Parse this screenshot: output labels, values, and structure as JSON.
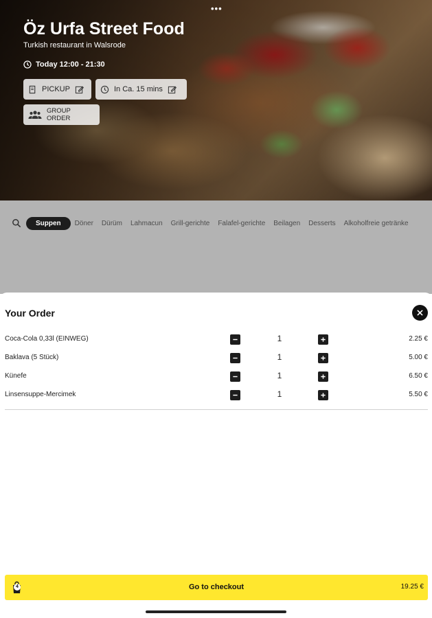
{
  "header": {
    "restaurant_name": "Öz Urfa Street Food",
    "subtitle": "Turkish restaurant in Walsrode",
    "hours": "Today 12:00 - 21:30",
    "pickup_label": "PICKUP",
    "time_label": "In Ca. 15 mins",
    "group_order_label": "GROUP ORDER",
    "menu_dots": "•••"
  },
  "categories": {
    "active": "Suppen",
    "items": [
      "Döner",
      "Dürüm",
      "Lahmacun",
      "Grill-gerichte",
      "Falafel-gerichte",
      "Beilagen",
      "Desserts",
      "Alkoholfreie getränke"
    ]
  },
  "order": {
    "title": "Your Order",
    "items": [
      {
        "name": "Coca-Cola 0,33l (EINWEG)",
        "qty": "1",
        "price": "2.25 €"
      },
      {
        "name": "Baklava (5 Stück)",
        "qty": "1",
        "price": "5.00 €"
      },
      {
        "name": "Künefe",
        "qty": "1",
        "price": "6.50 €"
      },
      {
        "name": "Linsensuppe-Mercimek",
        "qty": "1",
        "price": "5.50 €"
      }
    ]
  },
  "checkout": {
    "label": "Go to checkout",
    "total": "19.25 €",
    "item_count": "4"
  },
  "colors": {
    "accent": "#ffe72e",
    "dark": "#1d1d1d",
    "overlay": "#b3b3b3"
  }
}
